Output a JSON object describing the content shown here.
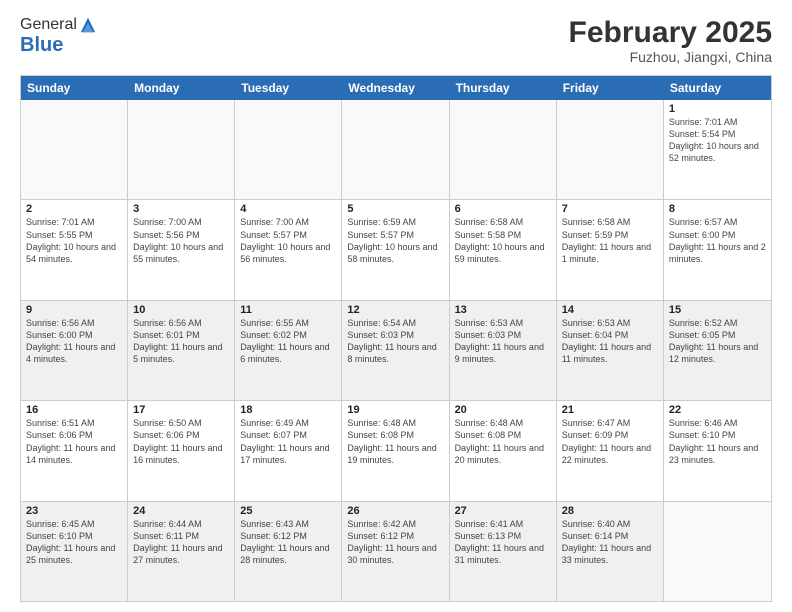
{
  "logo": {
    "general": "General",
    "blue": "Blue"
  },
  "title": "February 2025",
  "location": "Fuzhou, Jiangxi, China",
  "weekdays": [
    "Sunday",
    "Monday",
    "Tuesday",
    "Wednesday",
    "Thursday",
    "Friday",
    "Saturday"
  ],
  "rows": [
    [
      {
        "day": "",
        "info": "",
        "empty": true
      },
      {
        "day": "",
        "info": "",
        "empty": true
      },
      {
        "day": "",
        "info": "",
        "empty": true
      },
      {
        "day": "",
        "info": "",
        "empty": true
      },
      {
        "day": "",
        "info": "",
        "empty": true
      },
      {
        "day": "",
        "info": "",
        "empty": true
      },
      {
        "day": "1",
        "info": "Sunrise: 7:01 AM\nSunset: 5:54 PM\nDaylight: 10 hours and 52 minutes."
      }
    ],
    [
      {
        "day": "2",
        "info": "Sunrise: 7:01 AM\nSunset: 5:55 PM\nDaylight: 10 hours and 54 minutes."
      },
      {
        "day": "3",
        "info": "Sunrise: 7:00 AM\nSunset: 5:56 PM\nDaylight: 10 hours and 55 minutes."
      },
      {
        "day": "4",
        "info": "Sunrise: 7:00 AM\nSunset: 5:57 PM\nDaylight: 10 hours and 56 minutes."
      },
      {
        "day": "5",
        "info": "Sunrise: 6:59 AM\nSunset: 5:57 PM\nDaylight: 10 hours and 58 minutes."
      },
      {
        "day": "6",
        "info": "Sunrise: 6:58 AM\nSunset: 5:58 PM\nDaylight: 10 hours and 59 minutes."
      },
      {
        "day": "7",
        "info": "Sunrise: 6:58 AM\nSunset: 5:59 PM\nDaylight: 11 hours and 1 minute."
      },
      {
        "day": "8",
        "info": "Sunrise: 6:57 AM\nSunset: 6:00 PM\nDaylight: 11 hours and 2 minutes."
      }
    ],
    [
      {
        "day": "9",
        "info": "Sunrise: 6:56 AM\nSunset: 6:00 PM\nDaylight: 11 hours and 4 minutes.",
        "shaded": true
      },
      {
        "day": "10",
        "info": "Sunrise: 6:56 AM\nSunset: 6:01 PM\nDaylight: 11 hours and 5 minutes.",
        "shaded": true
      },
      {
        "day": "11",
        "info": "Sunrise: 6:55 AM\nSunset: 6:02 PM\nDaylight: 11 hours and 6 minutes.",
        "shaded": true
      },
      {
        "day": "12",
        "info": "Sunrise: 6:54 AM\nSunset: 6:03 PM\nDaylight: 11 hours and 8 minutes.",
        "shaded": true
      },
      {
        "day": "13",
        "info": "Sunrise: 6:53 AM\nSunset: 6:03 PM\nDaylight: 11 hours and 9 minutes.",
        "shaded": true
      },
      {
        "day": "14",
        "info": "Sunrise: 6:53 AM\nSunset: 6:04 PM\nDaylight: 11 hours and 11 minutes.",
        "shaded": true
      },
      {
        "day": "15",
        "info": "Sunrise: 6:52 AM\nSunset: 6:05 PM\nDaylight: 11 hours and 12 minutes.",
        "shaded": true
      }
    ],
    [
      {
        "day": "16",
        "info": "Sunrise: 6:51 AM\nSunset: 6:06 PM\nDaylight: 11 hours and 14 minutes."
      },
      {
        "day": "17",
        "info": "Sunrise: 6:50 AM\nSunset: 6:06 PM\nDaylight: 11 hours and 16 minutes."
      },
      {
        "day": "18",
        "info": "Sunrise: 6:49 AM\nSunset: 6:07 PM\nDaylight: 11 hours and 17 minutes."
      },
      {
        "day": "19",
        "info": "Sunrise: 6:48 AM\nSunset: 6:08 PM\nDaylight: 11 hours and 19 minutes."
      },
      {
        "day": "20",
        "info": "Sunrise: 6:48 AM\nSunset: 6:08 PM\nDaylight: 11 hours and 20 minutes."
      },
      {
        "day": "21",
        "info": "Sunrise: 6:47 AM\nSunset: 6:09 PM\nDaylight: 11 hours and 22 minutes."
      },
      {
        "day": "22",
        "info": "Sunrise: 6:46 AM\nSunset: 6:10 PM\nDaylight: 11 hours and 23 minutes."
      }
    ],
    [
      {
        "day": "23",
        "info": "Sunrise: 6:45 AM\nSunset: 6:10 PM\nDaylight: 11 hours and 25 minutes.",
        "shaded": true
      },
      {
        "day": "24",
        "info": "Sunrise: 6:44 AM\nSunset: 6:11 PM\nDaylight: 11 hours and 27 minutes.",
        "shaded": true
      },
      {
        "day": "25",
        "info": "Sunrise: 6:43 AM\nSunset: 6:12 PM\nDaylight: 11 hours and 28 minutes.",
        "shaded": true
      },
      {
        "day": "26",
        "info": "Sunrise: 6:42 AM\nSunset: 6:12 PM\nDaylight: 11 hours and 30 minutes.",
        "shaded": true
      },
      {
        "day": "27",
        "info": "Sunrise: 6:41 AM\nSunset: 6:13 PM\nDaylight: 11 hours and 31 minutes.",
        "shaded": true
      },
      {
        "day": "28",
        "info": "Sunrise: 6:40 AM\nSunset: 6:14 PM\nDaylight: 11 hours and 33 minutes.",
        "shaded": true
      },
      {
        "day": "",
        "info": "",
        "empty": true,
        "shaded": true
      }
    ]
  ]
}
